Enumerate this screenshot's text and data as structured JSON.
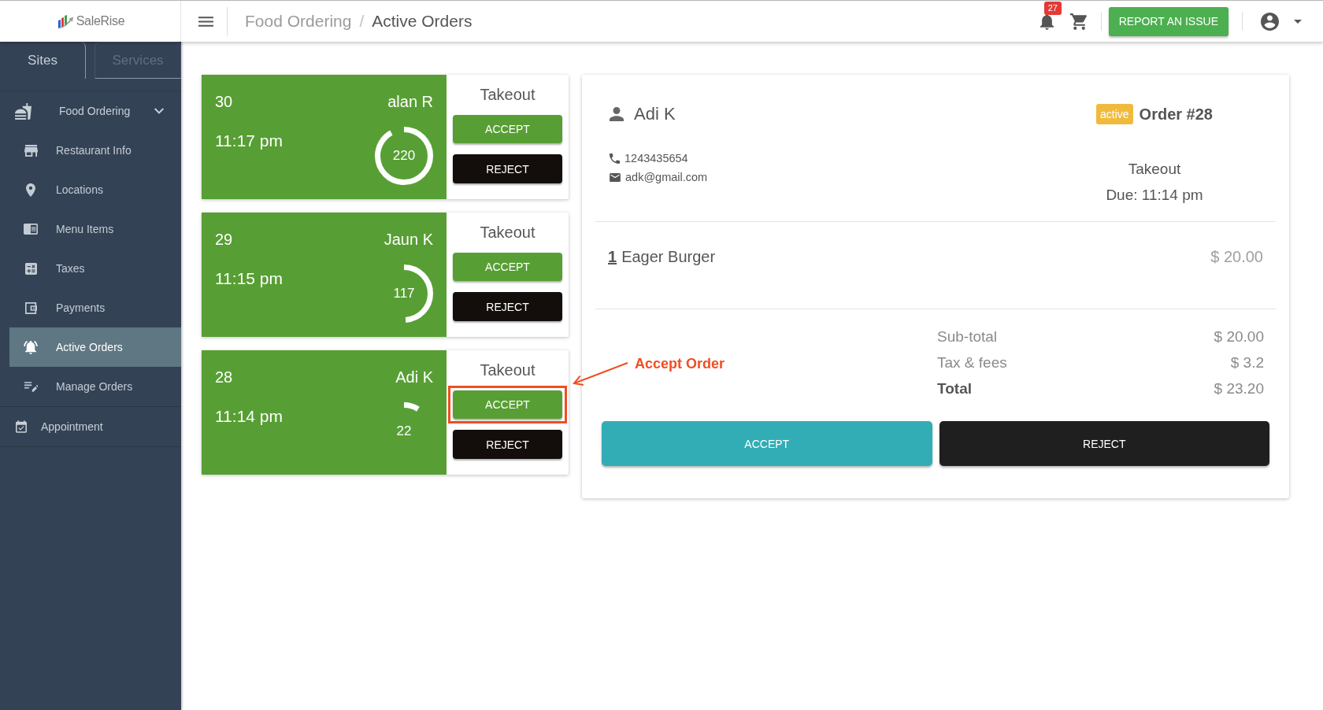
{
  "logo": {
    "text": "SaleRise"
  },
  "header": {
    "breadcrumb": [
      {
        "label": "Food Ordering",
        "current": false
      },
      {
        "label": "Active Orders",
        "current": true
      }
    ],
    "separator": "/",
    "notification_count": "27",
    "report_button": "REPORT AN ISSUE"
  },
  "sidebar": {
    "tabs": [
      {
        "label": "Sites",
        "selected": true
      },
      {
        "label": "Services",
        "selected": false
      }
    ],
    "items": [
      {
        "label": "Food Ordering",
        "selected": false,
        "expanded": true,
        "children": [
          {
            "label": "Restaurant Info",
            "selected": false
          },
          {
            "label": "Locations",
            "selected": false
          },
          {
            "label": "Menu Items",
            "selected": false
          },
          {
            "label": "Taxes",
            "selected": false
          },
          {
            "label": "Payments",
            "selected": false
          },
          {
            "label": "Active Orders",
            "selected": true
          },
          {
            "label": "Manage Orders",
            "selected": false
          }
        ]
      },
      {
        "label": "Appointment",
        "selected": false
      }
    ]
  },
  "orders": [
    {
      "number": "30",
      "customer": "alan R",
      "time": "11:17 pm",
      "timer": "220",
      "level": 0.92,
      "type": "Takeout",
      "accept": "ACCEPT",
      "reject": "REJECT",
      "highlighted": false
    },
    {
      "number": "29",
      "customer": "Jaun K",
      "time": "11:15 pm",
      "timer": "117",
      "level": 0.49,
      "type": "Takeout",
      "accept": "ACCEPT",
      "reject": "REJECT",
      "highlighted": false
    },
    {
      "number": "28",
      "customer": "Adi K",
      "time": "11:14 pm",
      "timer": "22",
      "level": 0.09,
      "type": "Takeout",
      "accept": "ACCEPT",
      "reject": "REJECT",
      "highlighted": true
    }
  ],
  "annotation": {
    "label": "Accept Order"
  },
  "detail": {
    "customer": "Adi K",
    "status": "active",
    "title": "Order #28",
    "phone": "1243435654",
    "email": "adk@gmail.com",
    "type": "Takeout",
    "due": "Due: 11:14 pm",
    "items": [
      {
        "quantity": "1",
        "name": "Eager Burger",
        "price": "$ 20.00"
      }
    ],
    "summary": [
      {
        "kind": "line",
        "label": "Sub-total",
        "value": "$ 20.00"
      },
      {
        "kind": "line",
        "label": "Tax & fees",
        "value": "$ 3.2"
      },
      {
        "kind": "total",
        "label": "Total",
        "value": "$ 23.20"
      }
    ],
    "accept": "ACCEPT",
    "reject": "REJECT"
  }
}
